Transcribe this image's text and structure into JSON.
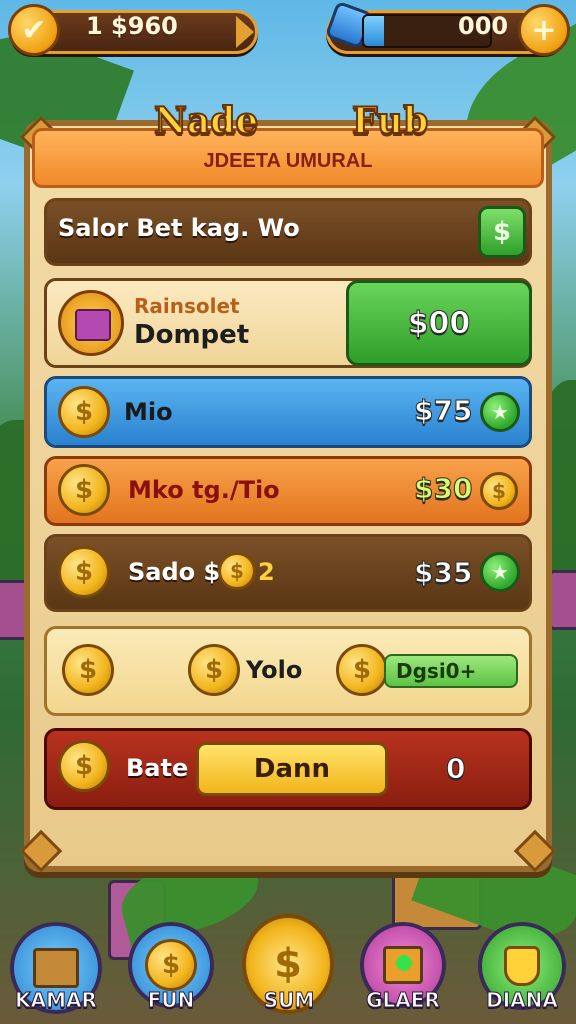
{
  "hud": {
    "left_value": "1 $960",
    "right_value": "000",
    "left_button_icon": "checkmark-icon",
    "right_button_icon": "plus-icon",
    "right_badge_icon": "gem-icon"
  },
  "panel": {
    "title_left": "Nade",
    "title_right": "Fub",
    "subtitle": "JDEETA UMURAL"
  },
  "rows": [
    {
      "label": "Salor Bet kag. Wo",
      "button_icon": "dollar-icon",
      "button_glyph": "$"
    },
    {
      "label_small": "Rainsolet",
      "label_main": "Dompet",
      "button_label": "$00",
      "icon": "treasure-box-icon"
    },
    {
      "label": "Mio",
      "value": "$75",
      "icon": "coin-icon",
      "action_icon": "star-icon"
    },
    {
      "label": "Mko tg./Tio",
      "value": "$30",
      "icon": "coin-stack-icon",
      "action_icon": "coin-icon"
    },
    {
      "label": "Sado $",
      "label_suffix": "2",
      "value": "$35",
      "icon": "coin-stack-icon",
      "action_icon": "star-icon"
    },
    {
      "middle_label": "Yolo",
      "field_value": "Dgsi0+",
      "icon": "coin-icon"
    },
    {
      "label": "Bate",
      "button_label": "Dann",
      "value": "0",
      "icon": "coin-stack-icon"
    }
  ],
  "nav": [
    {
      "label": "KAMAR",
      "icon": "treasure-chest-icon"
    },
    {
      "label": "FUN",
      "icon": "coin-icon"
    },
    {
      "label": "SUM",
      "icon": "coin-icon"
    },
    {
      "label": "GLAER",
      "icon": "gem-box-icon"
    },
    {
      "label": "DIANA",
      "icon": "trophy-icon"
    }
  ],
  "colors": {
    "gold": "#f2b51c",
    "panel": "#f3dca8",
    "blue_row": "#3a9be0",
    "orange_row": "#f08a2a",
    "green_button": "#4cc24a",
    "red_row": "#a32a1a"
  }
}
